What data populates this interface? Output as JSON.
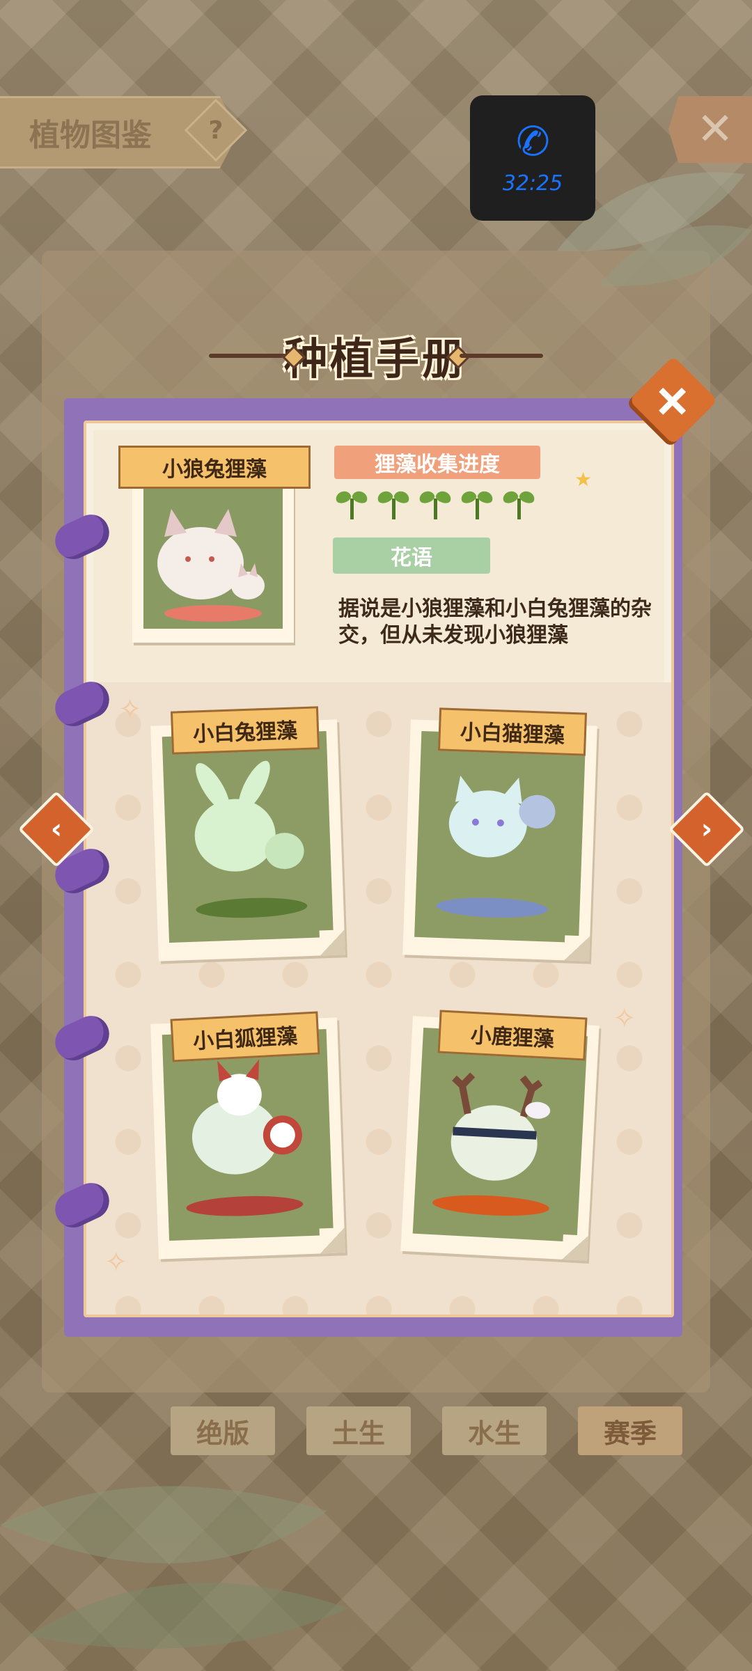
{
  "header": {
    "title": "植物图鉴",
    "help_icon": "?",
    "close_icon": "✕"
  },
  "call": {
    "time": "32:25",
    "icon": "phone-icon"
  },
  "background": {
    "tabs": [
      "绝版",
      "土生",
      "水生",
      "赛季"
    ]
  },
  "book": {
    "title": "种植手册",
    "close_icon": "+",
    "featured": {
      "name": "小狼兔狸藻",
      "progress_label": "狸藻收集进度",
      "progress_count": 5,
      "flower_lang_label": "花语",
      "flower_lang_text": "据说是小狼狸藻和小白兔狸藻的杂交，但从未发现小狼狸藻"
    },
    "cards": [
      {
        "name": "小白兔狸藻"
      },
      {
        "name": "小白猫狸藻"
      },
      {
        "name": "小白狐狸藻"
      },
      {
        "name": "小鹿狸藻"
      }
    ],
    "prev_icon": "‹",
    "next_icon": "›"
  }
}
